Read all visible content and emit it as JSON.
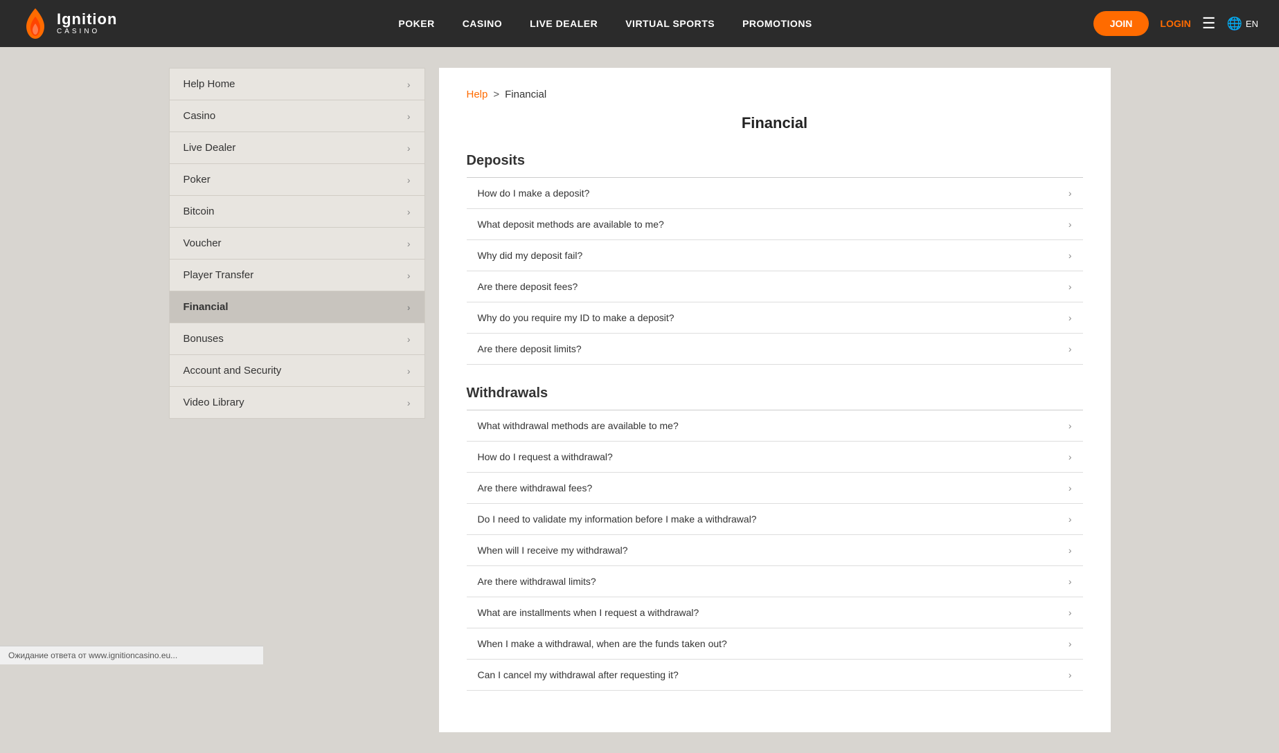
{
  "header": {
    "logo_main": "Ignition",
    "logo_sub": "CASINO",
    "nav": [
      {
        "label": "POKER",
        "id": "poker"
      },
      {
        "label": "CASINO",
        "id": "casino"
      },
      {
        "label": "LIVE DEALER",
        "id": "live-dealer"
      },
      {
        "label": "VIRTUAL SPORTS",
        "id": "virtual-sports"
      },
      {
        "label": "PROMOTIONS",
        "id": "promotions"
      }
    ],
    "join_label": "JOIN",
    "login_label": "LOGIN",
    "lang_label": "EN"
  },
  "breadcrumb": {
    "help_label": "Help",
    "separator": ">",
    "current": "Financial"
  },
  "sidebar": {
    "items": [
      {
        "label": "Help Home",
        "id": "help-home",
        "active": false
      },
      {
        "label": "Casino",
        "id": "casino",
        "active": false
      },
      {
        "label": "Live Dealer",
        "id": "live-dealer",
        "active": false
      },
      {
        "label": "Poker",
        "id": "poker",
        "active": false
      },
      {
        "label": "Bitcoin",
        "id": "bitcoin",
        "active": false
      },
      {
        "label": "Voucher",
        "id": "voucher",
        "active": false
      },
      {
        "label": "Player Transfer",
        "id": "player-transfer",
        "active": false
      },
      {
        "label": "Financial",
        "id": "financial",
        "active": true
      },
      {
        "label": "Bonuses",
        "id": "bonuses",
        "active": false
      },
      {
        "label": "Account and Security",
        "id": "account-security",
        "active": false
      },
      {
        "label": "Video Library",
        "id": "video-library",
        "active": false
      }
    ]
  },
  "content": {
    "title": "Financial",
    "deposits_section": {
      "heading": "Deposits",
      "items": [
        "How do I make a deposit?",
        "What deposit methods are available to me?",
        "Why did my deposit fail?",
        "Are there deposit fees?",
        "Why do you require my ID to make a deposit?",
        "Are there deposit limits?"
      ]
    },
    "withdrawals_section": {
      "heading": "Withdrawals",
      "items": [
        "What withdrawal methods are available to me?",
        "How do I request a withdrawal?",
        "Are there withdrawal fees?",
        "Do I need to validate my information before I make a withdrawal?",
        "When will I receive my withdrawal?",
        "Are there withdrawal limits?",
        "What are installments when I request a withdrawal?",
        "When I make a withdrawal, when are the funds taken out?",
        "Can I cancel my withdrawal after requesting it?"
      ]
    }
  },
  "status_bar": {
    "text": "Ожидание ответа от www.ignitioncasino.eu..."
  }
}
